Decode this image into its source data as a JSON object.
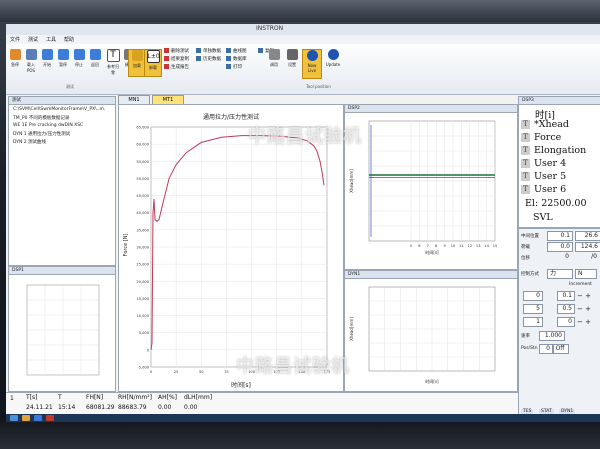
{
  "window": {
    "title": "INSTRON"
  },
  "menu": [
    "文件",
    "测试",
    "工具",
    "帮助"
  ],
  "ribbon": {
    "buttons": [
      {
        "label": "急停",
        "color": "#e08a2a"
      },
      {
        "label": "载入POS",
        "color": "#5a7fb8"
      },
      {
        "label": "开始",
        "color": "#3b7dd8"
      },
      {
        "label": "暂停",
        "color": "#3b7dd8"
      },
      {
        "label": "停止",
        "color": "#3b7dd8"
      },
      {
        "label": "返回",
        "color": "#3b7dd8"
      },
      {
        "label": "参考归零",
        "color": "#555555"
      },
      {
        "label": "横梁",
        "color": "#777777"
      },
      {
        "label": "加载",
        "color": "#d9a21f"
      },
      {
        "label": "卸载",
        "color": "#d9a21f"
      }
    ],
    "group_labels": [
      "测试",
      "",
      "",
      "",
      "",
      "",
      "",
      "",
      "Tool position"
    ],
    "small_items": [
      "删除测试",
      "结果复制",
      "生成报告",
      "单独数据",
      "历史数据",
      "曲线图",
      "数据库",
      "打印",
      "复制"
    ],
    "right_buttons": [
      {
        "label": "调用"
      },
      {
        "label": "设置"
      },
      {
        "label": "Now Live"
      },
      {
        "label": "Update"
      }
    ]
  },
  "tree": {
    "title": "测试",
    "items": [
      "C:\\SVM\\Cell\\SwmMonitorFrame\\V_PX\\..m.",
      "TM_P0  不同的模板数据记录",
      "WE 1E  Pre cracking  dwDIN  XSC",
      "DYN 1  通用拉力/压力性测试",
      "DYN 2  测试曲线"
    ]
  },
  "tabs": [
    "MN1",
    "MT1"
  ],
  "main_chart": {
    "title": "通用拉力/压力性测试",
    "ylabel": "Force [N]",
    "xlabel": "时间[s]"
  },
  "chart_data": [
    {
      "type": "line",
      "title": "通用拉力/压力性测试",
      "xlabel": "时间[s]",
      "ylabel": "Force [N]",
      "xlim": [
        0,
        175
      ],
      "ylim": [
        -5000,
        65000
      ],
      "x_ticks": [
        0,
        25,
        50,
        75,
        100,
        125,
        150,
        175
      ],
      "y_ticks": [
        -5000,
        0,
        5000,
        10000,
        15000,
        20000,
        25000,
        30000,
        35000,
        40000,
        45000,
        50000,
        55000,
        60000,
        65000
      ],
      "series": [
        {
          "x": [
            0,
            1,
            2,
            3,
            4,
            6,
            8,
            12,
            18,
            25,
            35,
            50,
            70,
            90,
            110,
            130,
            145,
            155,
            162,
            165,
            168,
            170,
            172
          ],
          "y": [
            0,
            2000,
            40000,
            44000,
            38000,
            37500,
            38000,
            43000,
            50000,
            54000,
            57500,
            60500,
            62000,
            62500,
            62500,
            62300,
            61800,
            61000,
            59500,
            58000,
            55000,
            52000,
            48000
          ]
        }
      ],
      "grid": true
    },
    {
      "type": "line",
      "title": "",
      "xlabel": "时间[s]",
      "ylabel": "Xhead[mm]",
      "xlim": [
        0,
        15
      ],
      "ylim": [
        -1,
        1
      ],
      "x_ticks": [
        5,
        6,
        7,
        8,
        9,
        10,
        11,
        12,
        13,
        14,
        15
      ],
      "grid": true
    },
    {
      "type": "line",
      "title": "",
      "xlabel": "时间[s]",
      "ylabel": "Xhead[mm]",
      "grid": true
    }
  ],
  "panels": {
    "dsp1": "DSP1",
    "dsp2": "DSP2",
    "dyn1": "DYN1",
    "dsp_r": "DSP3"
  },
  "display": {
    "title": "时[i]",
    "rows": [
      "*Xhead",
      "Force",
      "Elongation",
      "User 4",
      "User 5",
      "User 6",
      "El: 22500.00",
      "SVL"
    ]
  },
  "control": {
    "rows": [
      {
        "label": "中间位置",
        "v1": "0.1",
        "v2": "26.6"
      },
      {
        "label": "荷载",
        "v1": "0.0",
        "v2": "124.6"
      },
      {
        "label": "位移",
        "v1": "0",
        "v2": "/0"
      }
    ],
    "mode_label": "控制方式",
    "mode_value": "力",
    "mode_value2": "N",
    "increment_label": "Increment",
    "steps": [
      {
        "v": "0",
        "a": "0.1"
      },
      {
        "v": "5",
        "a": "0.5"
      },
      {
        "v": "1",
        "a": "0"
      }
    ],
    "rate_label": "速率",
    "rate": "1.000",
    "extra": "Pos/Stn",
    "extra_val": "0",
    "off": "Off",
    "tabs": [
      "TES",
      "STAT",
      "DYN1"
    ]
  },
  "status": {
    "headers": [
      "T[s]",
      "T",
      "FH[N]",
      "RH[N/mm²]",
      "AH[%]",
      "dLH[mm]"
    ],
    "values": [
      "24.11.21",
      "15:14",
      "68081.29",
      "88683.79",
      "0.00",
      "0.00"
    ],
    "index": "1"
  },
  "watermark": "中路昌试验机"
}
